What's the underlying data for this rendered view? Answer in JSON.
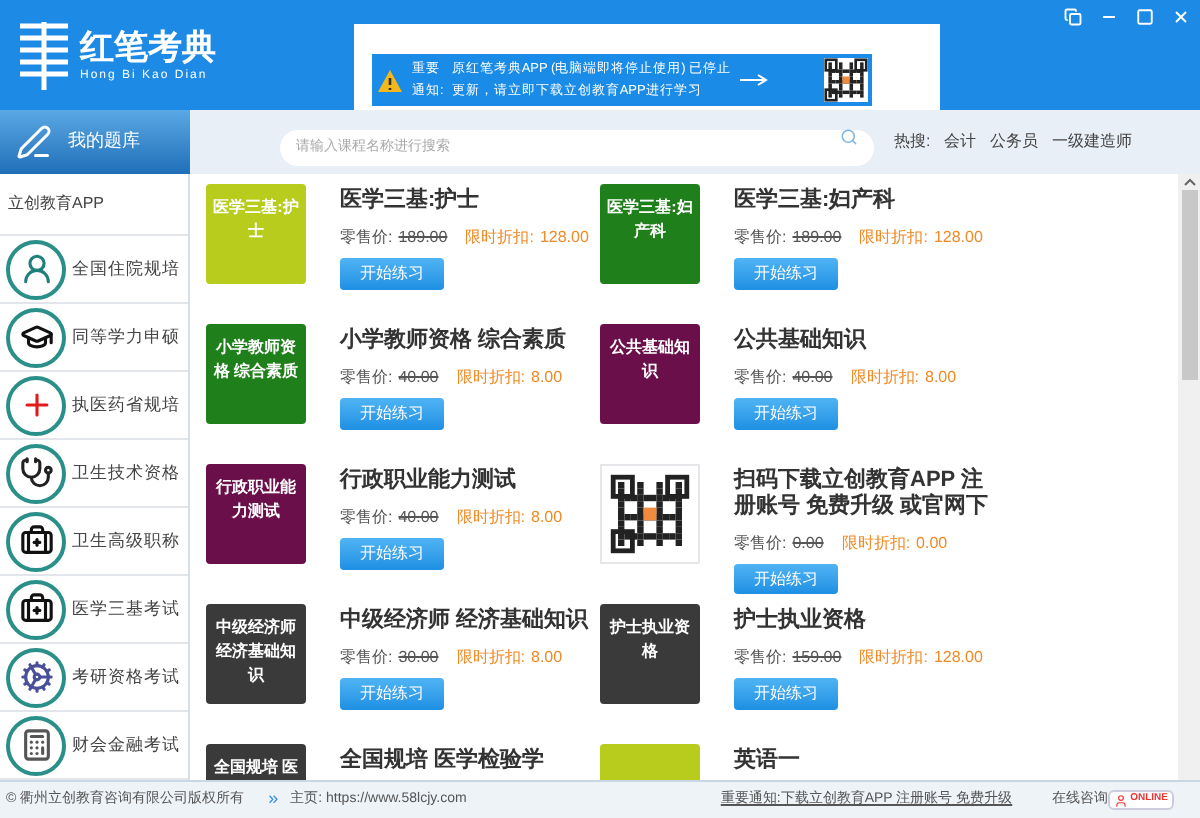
{
  "logo": {
    "name": "红笔考典",
    "pinyin": "Hong Bi Kao Dian"
  },
  "notice": {
    "labels": [
      "重要",
      "通知:"
    ],
    "lines": [
      "原红笔考典APP (电脑端即将停止使用) 已停止",
      "更新，请立即下载立创教育APP进行学习"
    ]
  },
  "tab": {
    "label": "我的题库",
    "selected": true
  },
  "search": {
    "placeholder": "请输入课程名称进行搜索"
  },
  "hot_search": {
    "label": "热搜:",
    "terms": [
      "会计",
      "公务员",
      "一级建造师"
    ]
  },
  "sidebar": {
    "title": "立创教育APP",
    "items": [
      {
        "label": "全国住院规培"
      },
      {
        "label": "同等学力申硕"
      },
      {
        "label": "执医药省规培"
      },
      {
        "label": "卫生技术资格"
      },
      {
        "label": "卫生高级职称"
      },
      {
        "label": "医学三基考试"
      },
      {
        "label": "考研资格考试"
      },
      {
        "label": "财会金融考试"
      }
    ]
  },
  "courses": [
    {
      "kind": "cover",
      "cover": "医学三基:护士",
      "color": "#b7cc1c",
      "title": "医学三基:护士",
      "retail_label": "零售价:",
      "retail": "189.00",
      "discount_label": "限时折扣:",
      "discount": "128.00",
      "button": "开始练习"
    },
    {
      "kind": "cover",
      "cover": "医学三基:妇产科",
      "color": "#1f7f1a",
      "title": "医学三基:妇产科",
      "retail_label": "零售价:",
      "retail": "189.00",
      "discount_label": "限时折扣:",
      "discount": "128.00",
      "button": "开始练习"
    },
    {
      "kind": "cover",
      "cover": "小学教师资格 综合素质",
      "color": "#1f7f1a",
      "title": "小学教师资格 综合素质",
      "retail_label": "零售价:",
      "retail": "40.00",
      "discount_label": "限时折扣:",
      "discount": "8.00",
      "button": "开始练习"
    },
    {
      "kind": "cover",
      "cover": "公共基础知识",
      "color": "#6a0f4a",
      "title": "公共基础知识",
      "retail_label": "零售价:",
      "retail": "40.00",
      "discount_label": "限时折扣:",
      "discount": "8.00",
      "button": "开始练习"
    },
    {
      "kind": "cover",
      "cover": "行政职业能力测试",
      "color": "#6a0f4a",
      "title": "行政职业能力测试",
      "retail_label": "零售价:",
      "retail": "40.00",
      "discount_label": "限时折扣:",
      "discount": "8.00",
      "button": "开始练习"
    },
    {
      "kind": "qr",
      "title": "扫码下载立创教育APP 注册账号 免费升级 或官网下",
      "retail_label": "零售价:",
      "retail": "0.00",
      "discount_label": "限时折扣:",
      "discount": "0.00",
      "button": "开始练习"
    },
    {
      "kind": "cover",
      "cover": "中级经济师经济基础知识",
      "color": "#3a3a3a",
      "title": "中级经济师 经济基础知识",
      "retail_label": "零售价:",
      "retail": "30.00",
      "discount_label": "限时折扣:",
      "discount": "8.00",
      "button": "开始练习"
    },
    {
      "kind": "cover",
      "cover": "护士执业资格",
      "color": "#3a3a3a",
      "title": "护士执业资格",
      "retail_label": "零售价:",
      "retail": "159.00",
      "discount_label": "限时折扣:",
      "discount": "128.00",
      "button": "开始练习"
    },
    {
      "kind": "cover",
      "cover": "全国规培 医",
      "color": "#3a3a3a",
      "title": "全国规培 医学检验学"
    },
    {
      "kind": "cover",
      "color": "#b7cc1c",
      "title": "英语一"
    }
  ],
  "footer": {
    "copyright": "© 衢州立创教育咨询有限公司版权所有",
    "arrow": "»",
    "homepage": "主页: https://www.58lcjy.com",
    "link": "重要通知:下载立创教育APP 注册账号 免费升级",
    "consult": "在线咨询",
    "online": "ONLINE"
  }
}
